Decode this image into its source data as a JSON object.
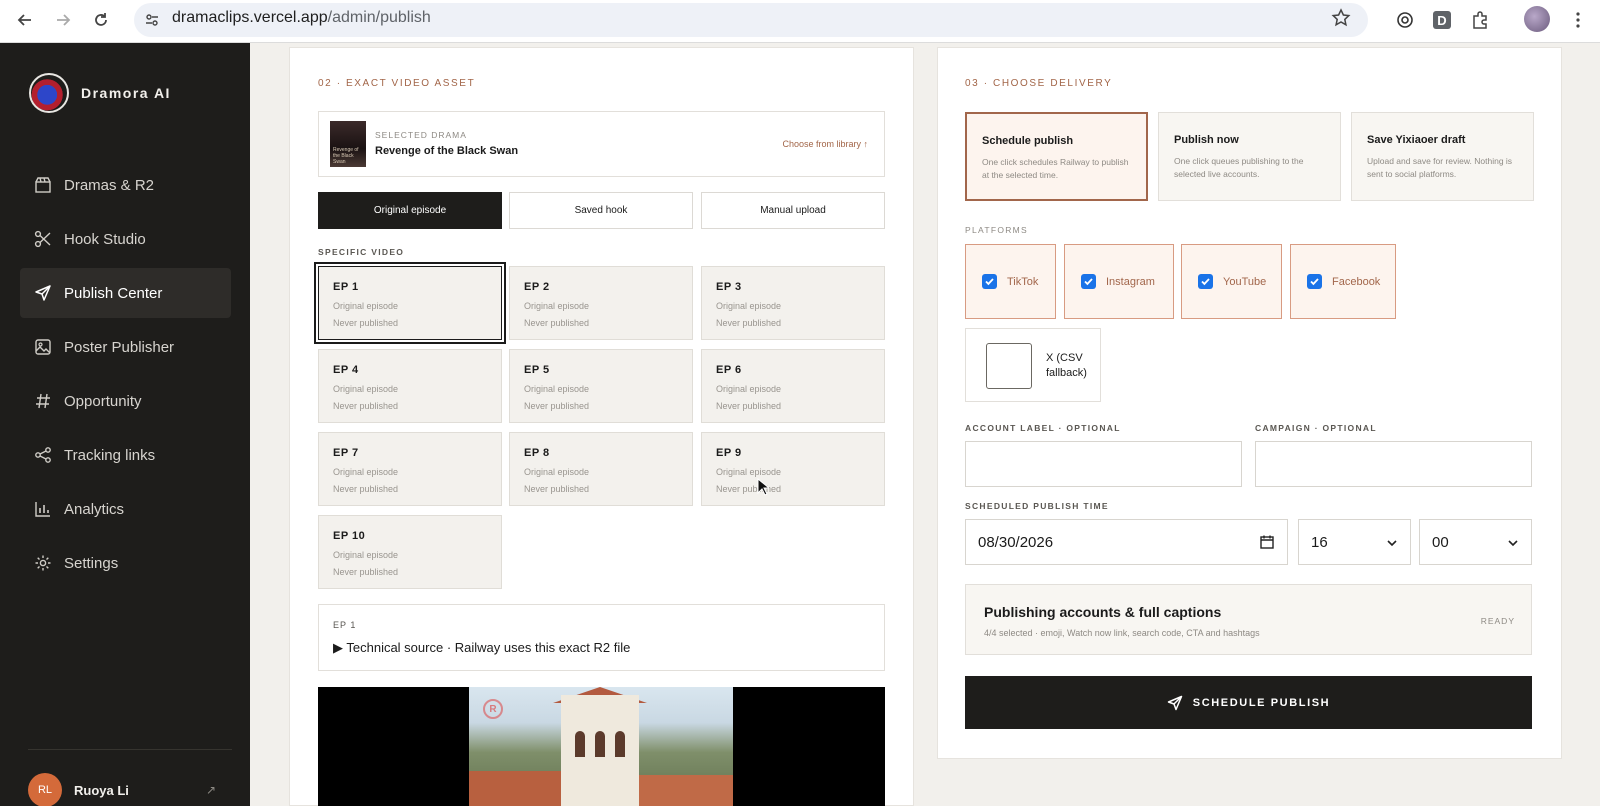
{
  "browser": {
    "url_host": "dramaclips.vercel.app",
    "url_path": "/admin/publish",
    "extension_letter": "D"
  },
  "brand": {
    "name": "Dramora AI"
  },
  "sidebar": {
    "items": [
      {
        "label": "Dramas & R2",
        "icon": "clapperboard-icon"
      },
      {
        "label": "Hook Studio",
        "icon": "scissors-icon"
      },
      {
        "label": "Publish Center",
        "icon": "send-icon"
      },
      {
        "label": "Poster Publisher",
        "icon": "image-icon"
      },
      {
        "label": "Opportunity",
        "icon": "hash-icon"
      },
      {
        "label": "Tracking links",
        "icon": "share-icon"
      },
      {
        "label": "Analytics",
        "icon": "bar-chart-icon"
      },
      {
        "label": "Settings",
        "icon": "gear-icon"
      }
    ],
    "active_index": 2,
    "user": {
      "initials": "RL",
      "name": "Ruoya Li"
    }
  },
  "asset": {
    "section_label": "02 · EXACT VIDEO ASSET",
    "selected_drama_label": "SELECTED DRAMA",
    "selected_drama_title": "Revenge of the Black Swan",
    "poster_text": "Revenge of the Black Swan",
    "choose_library": "Choose from library ↑",
    "source_tabs": [
      "Original episode",
      "Saved hook",
      "Manual upload"
    ],
    "active_source": 0,
    "specific_video_label": "SPECIFIC VIDEO",
    "episodes": [
      {
        "num": "EP 1",
        "type": "Original episode",
        "status": "Never published"
      },
      {
        "num": "EP 2",
        "type": "Original episode",
        "status": "Never published"
      },
      {
        "num": "EP 3",
        "type": "Original episode",
        "status": "Never published"
      },
      {
        "num": "EP 4",
        "type": "Original episode",
        "status": "Never published"
      },
      {
        "num": "EP 5",
        "type": "Original episode",
        "status": "Never published"
      },
      {
        "num": "EP 6",
        "type": "Original episode",
        "status": "Never published"
      },
      {
        "num": "EP 7",
        "type": "Original episode",
        "status": "Never published"
      },
      {
        "num": "EP 8",
        "type": "Original episode",
        "status": "Never published"
      },
      {
        "num": "EP 9",
        "type": "Original episode",
        "status": "Never published"
      },
      {
        "num": "EP 10",
        "type": "Original episode",
        "status": "Never published"
      }
    ],
    "selected_episode": 0,
    "technical": {
      "episode": "EP 1",
      "summary": "▶ Technical source · Railway uses this exact R2 file"
    },
    "video_watermark": "R"
  },
  "delivery": {
    "section_label": "03 · CHOOSE DELIVERY",
    "options": [
      {
        "title": "Schedule publish",
        "desc": "One click schedules Railway to publish at the selected time."
      },
      {
        "title": "Publish now",
        "desc": "One click queues publishing to the selected live accounts."
      },
      {
        "title": "Save Yixiaoer draft",
        "desc": "Upload and save for review. Nothing is sent to social platforms."
      }
    ],
    "active_option": 0,
    "platforms_label": "PLATFORMS",
    "platforms": [
      {
        "label": "TikTok",
        "checked": true
      },
      {
        "label": "Instagram",
        "checked": true
      },
      {
        "label": "YouTube",
        "checked": true
      },
      {
        "label": "Facebook",
        "checked": true
      },
      {
        "label": "X (CSV fallback)",
        "checked": false
      }
    ],
    "account_label_field": "ACCOUNT LABEL · OPTIONAL",
    "campaign_field": "CAMPAIGN · OPTIONAL",
    "account_value": "",
    "campaign_value": "",
    "schedule_label": "SCHEDULED PUBLISH TIME",
    "date": "08/30/2026",
    "hour": "16",
    "minute": "00",
    "accounts_title": "Publishing accounts & full captions",
    "accounts_sub": "4/4 selected · emoji, Watch now link, search code, CTA and hashtags",
    "accounts_status": "READY",
    "publish_button": "SCHEDULE PUBLISH"
  },
  "colors": {
    "accent": "#a2664b",
    "sidebar_bg": "#1e1d1b",
    "checkbox": "#1a73e8"
  }
}
